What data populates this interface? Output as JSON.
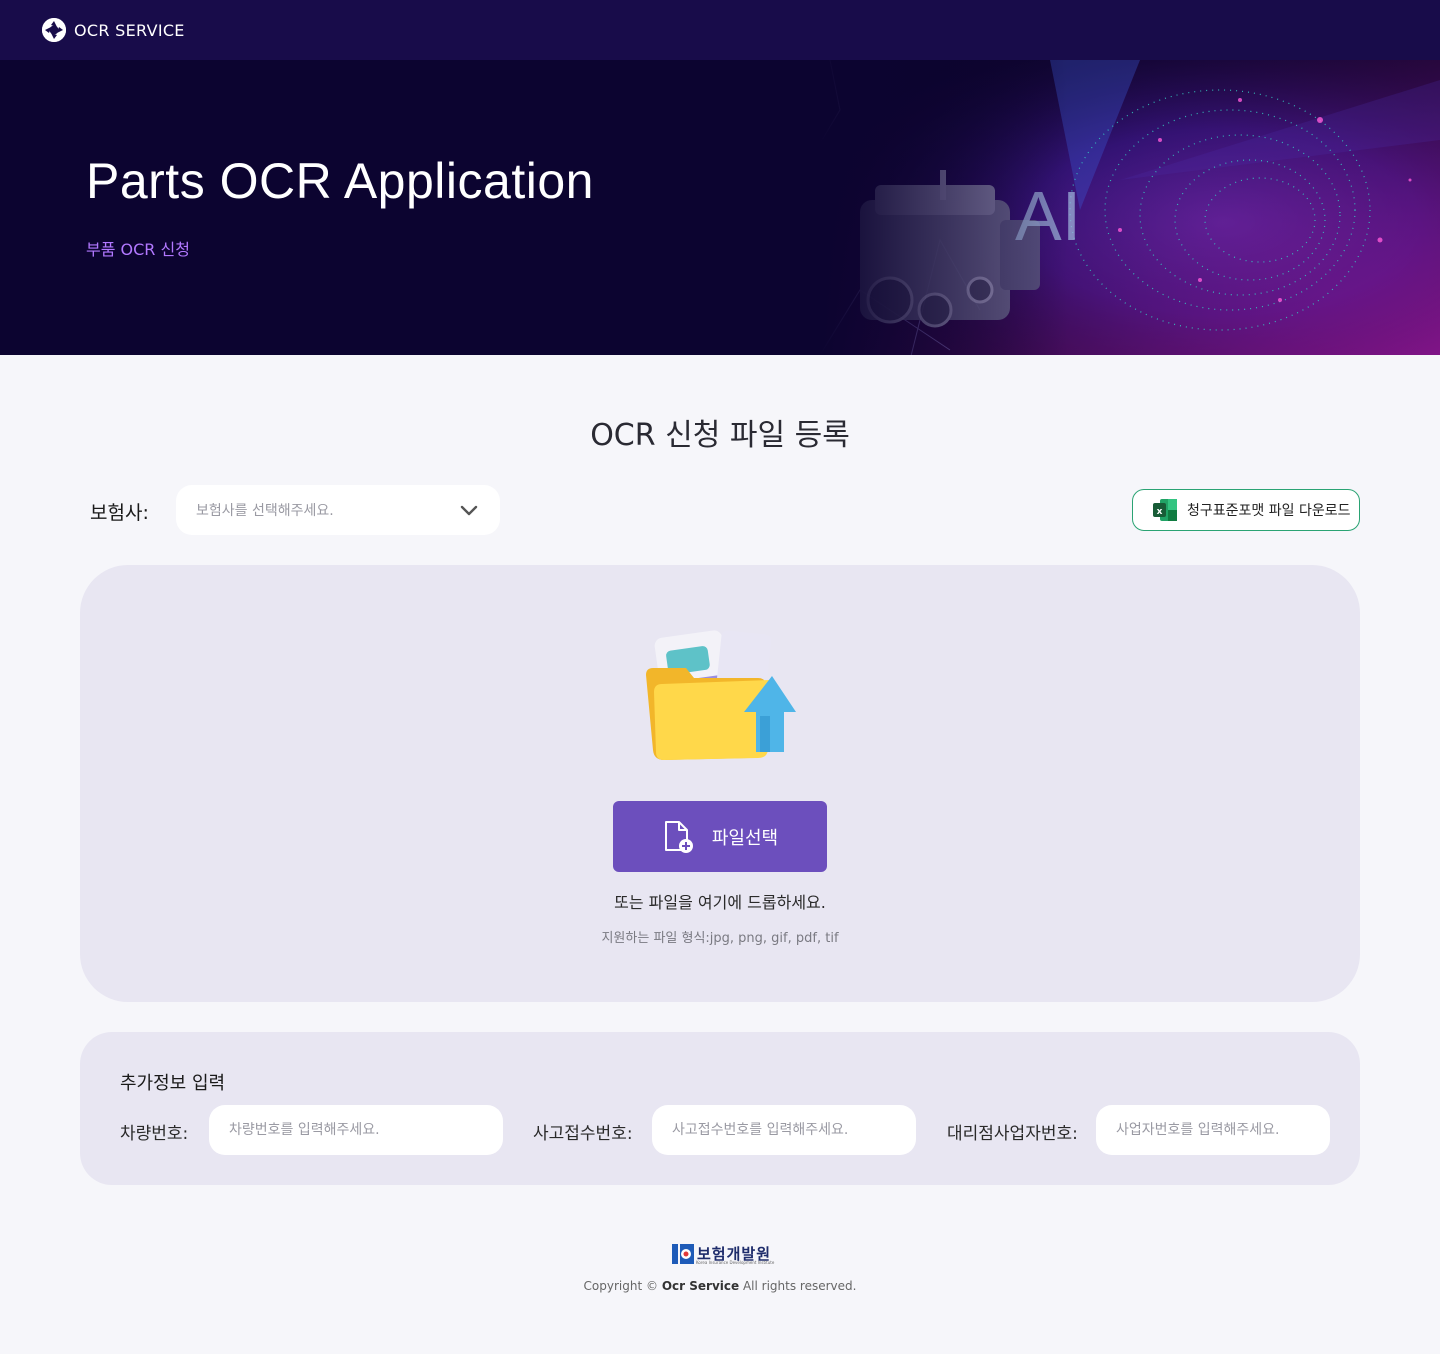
{
  "nav": {
    "brand": "OCR SERVICE",
    "brand_icon": "aperture-icon"
  },
  "hero": {
    "title": "Parts OCR Application",
    "subtitle": "부품 OCR 신청",
    "art_label": "AI"
  },
  "section": {
    "title": "OCR 신청 파일 등록"
  },
  "insurer": {
    "label": "보험사:",
    "placeholder": "보험사를 선택해주세요."
  },
  "excel_download": {
    "label": "청구표준포맷 파일 다운로드",
    "icon": "excel-icon"
  },
  "dropzone": {
    "button_label": "파일선택",
    "drop_text": "또는 파일을 여기에 드롭하세요.",
    "formats_text": "지원하는 파일 형식:jpg, png, gif, pdf, tif"
  },
  "extra": {
    "title": "추가정보 입력",
    "vehicle": {
      "label": "차량번호:",
      "placeholder": "차량번호를 입력해주세요."
    },
    "accident": {
      "label": "사고접수번호:",
      "placeholder": "사고접수번호를 입력해주세요."
    },
    "agency": {
      "label": "대리점사업자번호:",
      "placeholder": "사업자번호를 입력해주세요."
    }
  },
  "footer": {
    "org_name": "보험개발원",
    "org_tagline": "Korea Insurance Development Institute",
    "copyright_prefix": "Copyright ©",
    "copyright_brand": "Ocr Service",
    "copyright_suffix": "All rights reserved."
  },
  "colors": {
    "nav_bg": "#180c4a",
    "hero_bg": "#0c0430",
    "accent": "#6c4fbd",
    "subtitle": "#b278ff",
    "excel_green": "#2aa373"
  }
}
